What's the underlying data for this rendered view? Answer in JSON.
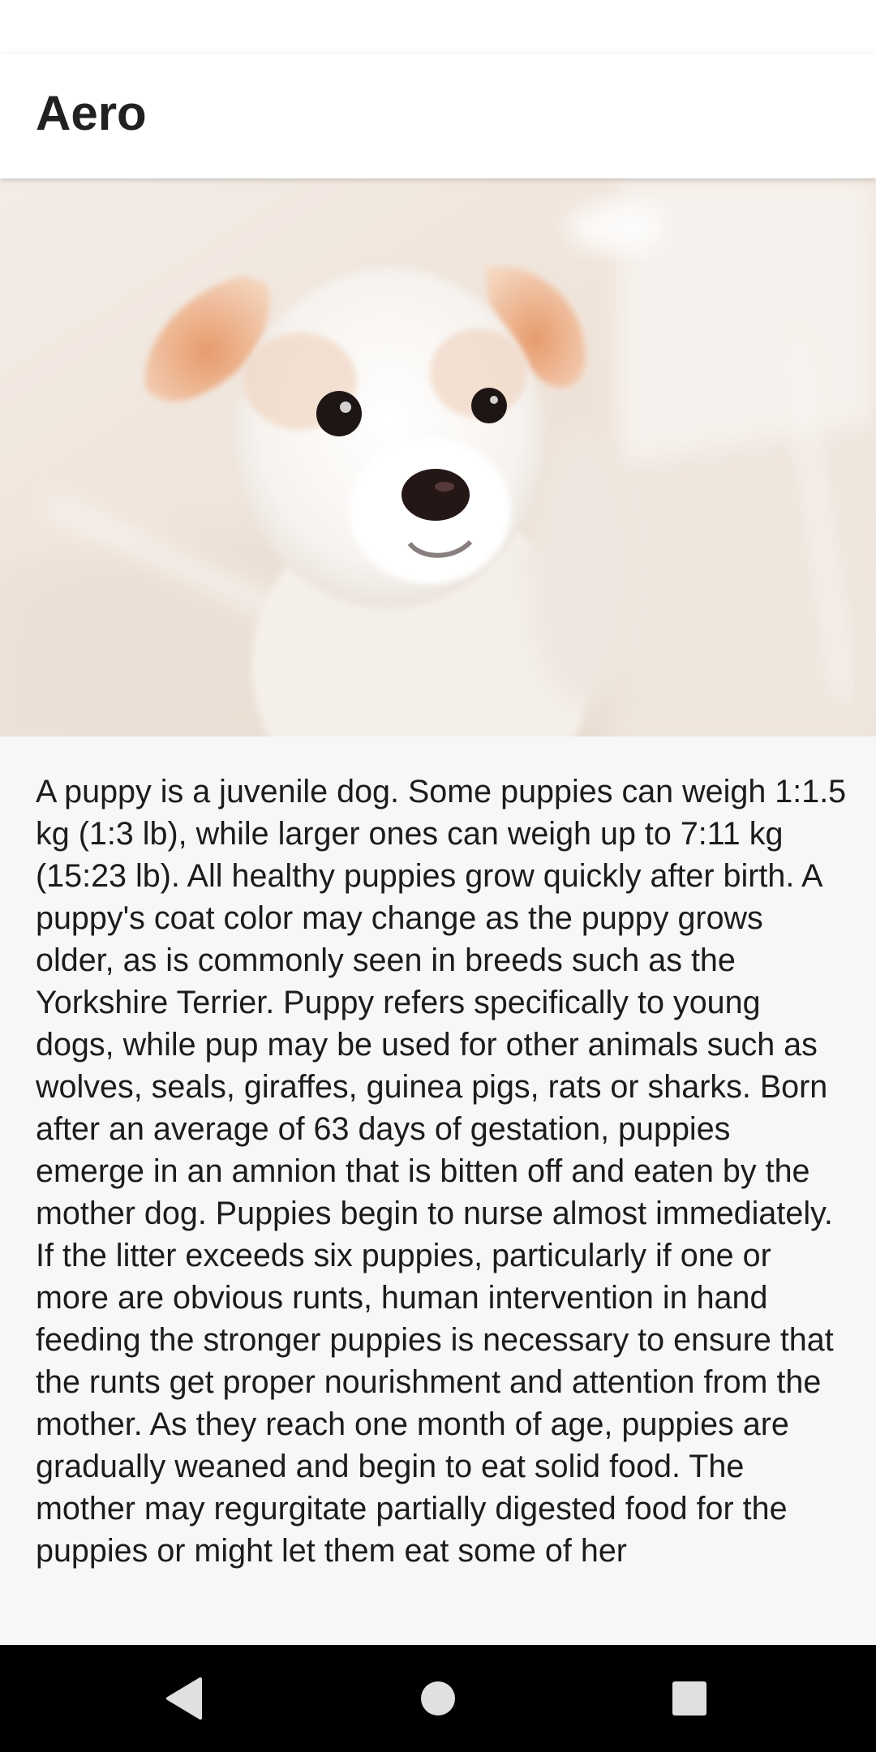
{
  "app_bar": {
    "title": "Aero"
  },
  "hero_image": {
    "subject": "white puppy with tan ears"
  },
  "article": {
    "body": "A puppy is a juvenile dog. Some puppies can weigh 1:1.5 kg (1:3 lb), while larger ones can weigh up to 7:11 kg (15:23 lb). All healthy puppies grow quickly after birth. A puppy's coat color may change as the puppy grows older, as is commonly seen in breeds such as the Yorkshire Terrier. Puppy refers specifically to young dogs, while pup may be used for other animals such as wolves, seals, giraffes, guinea pigs, rats or sharks. Born after an average of 63 days of gestation, puppies emerge in an amnion that is bitten off and eaten by the mother dog. Puppies begin to nurse almost immediately. If the litter exceeds six puppies, particularly if one or more are obvious runts, human intervention in hand feeding the stronger puppies is necessary to ensure that the runts get proper nourishment and attention from the mother. As they reach one month of age, puppies are gradually weaned and begin to eat solid food. The mother may regurgitate partially digested food for the puppies or might let them eat some of her"
  },
  "nav_bar": {
    "back_icon": "back-triangle-icon",
    "home_icon": "home-circle-icon",
    "recents_icon": "recents-square-icon"
  },
  "colors": {
    "app_bar_bg": "#ffffff",
    "page_bg": "#f7f7f7",
    "text": "#212121",
    "nav_bar_bg": "#000000",
    "nav_icon": "#e0e0e0"
  }
}
